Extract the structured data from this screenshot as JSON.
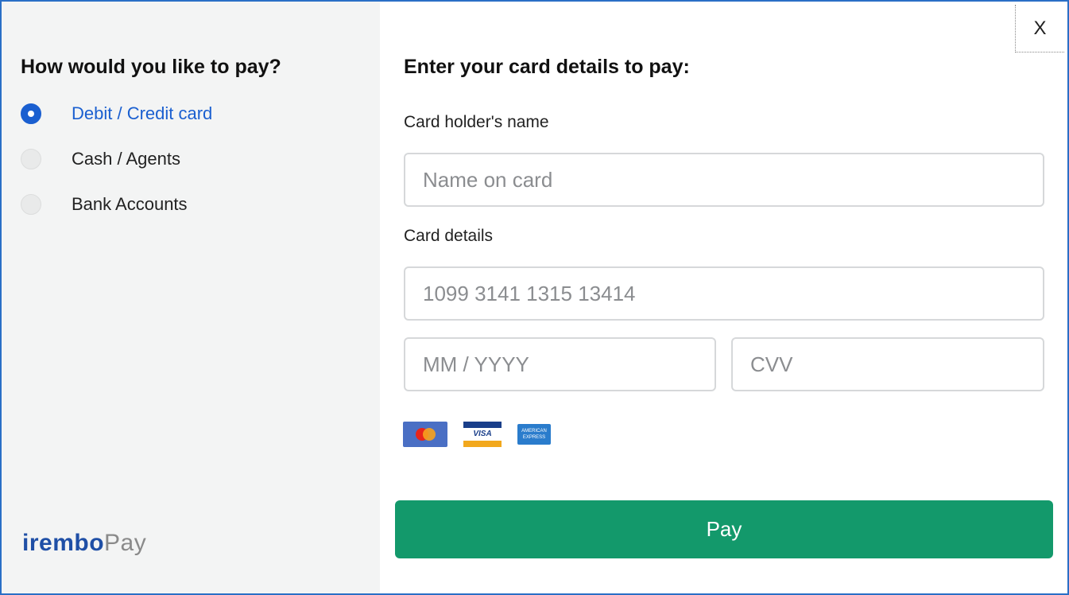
{
  "left_panel": {
    "title": "How would you like to pay?",
    "methods": [
      {
        "label": "Debit / Credit card",
        "selected": true
      },
      {
        "label": "Cash / Agents",
        "selected": false
      },
      {
        "label": "Bank Accounts",
        "selected": false
      }
    ],
    "logo": {
      "part1": "irembo",
      "part2": "Pay"
    }
  },
  "close_label": "X",
  "form": {
    "title": "Enter your card details to pay:",
    "holder_label": "Card holder's name",
    "holder_placeholder": "Name on card",
    "details_label": "Card details",
    "card_number_placeholder": "1099 3141 1315 13414",
    "expiry_placeholder": "MM / YYYY",
    "cvv_placeholder": "CVV",
    "card_brands": [
      "mastercard-icon",
      "visa-icon",
      "amex-icon"
    ],
    "visa_text": "VISA",
    "amex_text": "AMERICAN EXPRESS",
    "pay_label": "Pay"
  },
  "colors": {
    "border": "#2a6fc6",
    "accent": "#1a5fd0",
    "pay_button": "#13996b",
    "left_bg": "#f3f4f4"
  }
}
